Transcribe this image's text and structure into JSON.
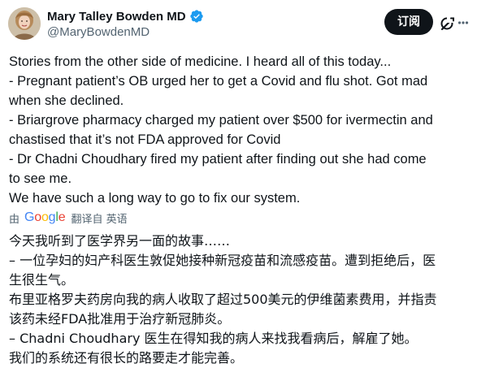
{
  "author": {
    "name": "Mary Talley Bowden MD",
    "handle": "@MaryBowdenMD",
    "verified": true
  },
  "actions": {
    "subscribe_label": "订阅",
    "grok_icon": "grok-icon",
    "more_icon": "more-icon"
  },
  "tweet": {
    "lines": [
      "Stories from the other side of  medicine. I heard all of this today...",
      "- Pregnant patient’s OB urged her to get a Covid and flu shot. Got mad",
      "when she declined.",
      "- Briargrove pharmacy charged my patient over $500 for ivermectin and",
      "chastised that it’s not FDA approved for Covid",
      "- Dr Chadni Choudhary fired my patient after finding out she had come",
      "to see me.",
      "We have such a long way to go to fix our system."
    ]
  },
  "translation": {
    "prefix": "由",
    "provider": "Google",
    "link_label": "翻译自 英语",
    "lines": [
      "今天我听到了医学界另一面的故事……",
      "– 一位孕妇的妇产科医生敦促她接种新冠疫苗和流感疫苗。遭到拒绝后，医",
      "生很生气。",
      "布里亚格罗夫药房向我的病人收取了超过500美元的伊维菌素费用，并指责",
      "该药未经FDA批准用于治疗新冠肺炎。",
      "– Chadni Choudhary 医生在得知我的病人来找我看病后，解雇了她。",
      "我们的系统还有很长的路要走才能完善。"
    ]
  },
  "colors": {
    "text": "#0f1419",
    "secondary": "#536471",
    "verified": "#1d9bf0",
    "button_bg": "#0f1419"
  }
}
